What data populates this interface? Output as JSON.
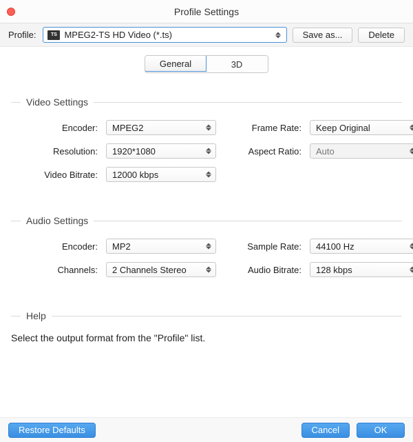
{
  "window": {
    "title": "Profile Settings"
  },
  "profile": {
    "label": "Profile:",
    "value": "MPEG2-TS HD Video (*.ts)",
    "icon_name": "ts-file-icon",
    "icon_text": "TS",
    "save_as_label": "Save as...",
    "delete_label": "Delete"
  },
  "tabs": {
    "general": "General",
    "three_d": "3D"
  },
  "video": {
    "legend": "Video Settings",
    "labels": {
      "encoder": "Encoder:",
      "resolution": "Resolution:",
      "video_bitrate": "Video Bitrate:",
      "frame_rate": "Frame Rate:",
      "aspect_ratio": "Aspect Ratio:"
    },
    "values": {
      "encoder": "MPEG2",
      "resolution": "1920*1080",
      "video_bitrate": "12000 kbps",
      "frame_rate": "Keep Original",
      "aspect_ratio": "Auto"
    }
  },
  "audio": {
    "legend": "Audio Settings",
    "labels": {
      "encoder": "Encoder:",
      "channels": "Channels:",
      "sample_rate": "Sample Rate:",
      "audio_bitrate": "Audio Bitrate:"
    },
    "values": {
      "encoder": "MP2",
      "channels": "2 Channels Stereo",
      "sample_rate": "44100 Hz",
      "audio_bitrate": "128 kbps"
    }
  },
  "help": {
    "legend": "Help",
    "text": "Select the output format from the \"Profile\" list."
  },
  "footer": {
    "restore": "Restore Defaults",
    "cancel": "Cancel",
    "ok": "OK"
  }
}
